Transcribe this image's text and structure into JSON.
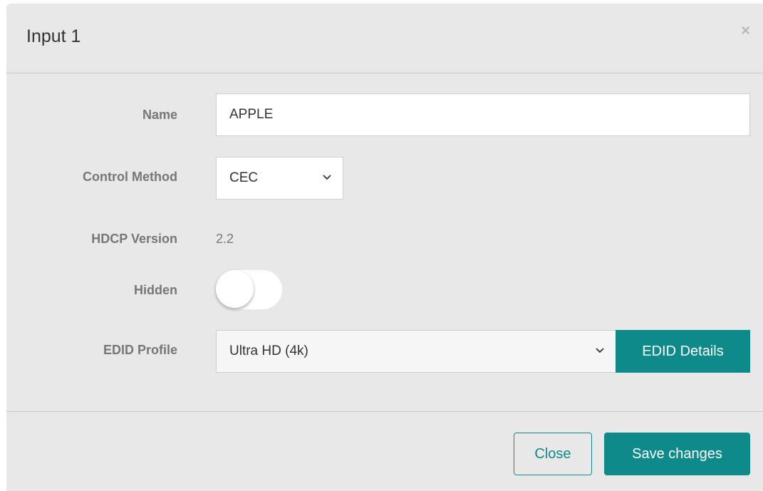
{
  "modal": {
    "title": "Input 1",
    "close_symbol": "×"
  },
  "form": {
    "name": {
      "label": "Name",
      "value": "APPLE"
    },
    "control_method": {
      "label": "Control Method",
      "selected": "CEC"
    },
    "hdcp_version": {
      "label": "HDCP Version",
      "value": "2.2"
    },
    "hidden": {
      "label": "Hidden",
      "state": "off"
    },
    "edid_profile": {
      "label": "EDID Profile",
      "selected": "Ultra HD (4k)",
      "details_button": "EDID Details"
    }
  },
  "footer": {
    "close_label": "Close",
    "save_label": "Save changes"
  },
  "colors": {
    "accent": "#0f8a8a",
    "panel": "#e8e8e8",
    "label": "#777777"
  },
  "icons": {
    "close": "close-icon",
    "select": "chevron-down-icon"
  }
}
